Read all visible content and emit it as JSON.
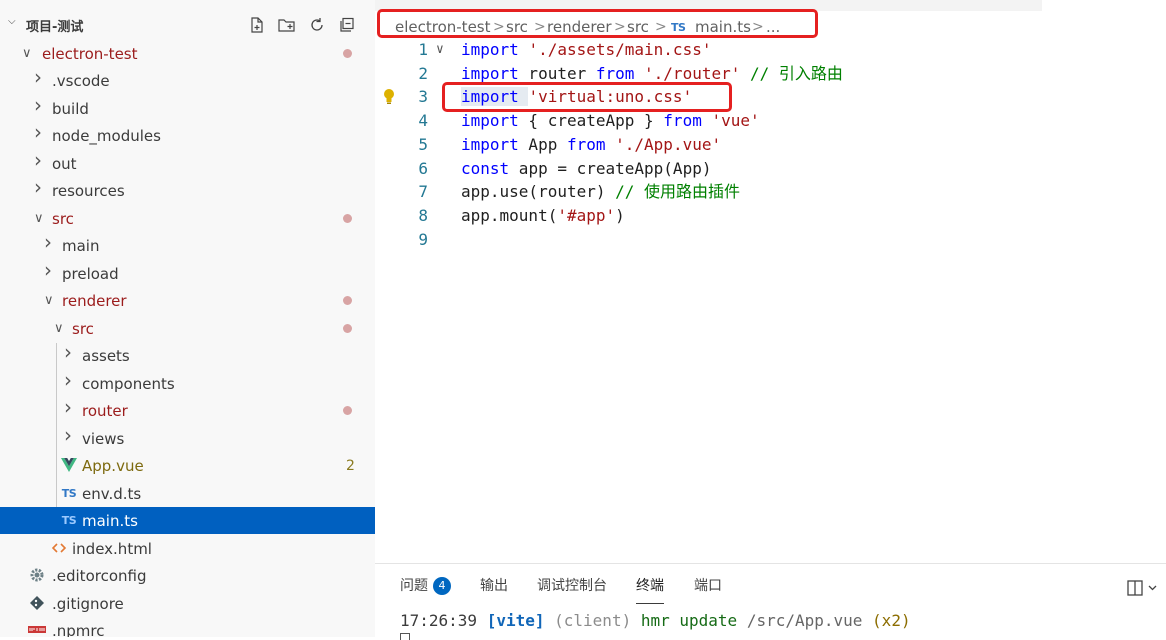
{
  "explorer": {
    "title": "项目-测试",
    "actions": [
      "new-file-icon",
      "new-folder-icon",
      "refresh-icon",
      "collapse-all-icon"
    ],
    "tree": [
      {
        "label": "electron-test",
        "kind": "folder-open",
        "modified": true
      },
      {
        "label": ".vscode",
        "kind": "folder"
      },
      {
        "label": "build",
        "kind": "folder"
      },
      {
        "label": "node_modules",
        "kind": "folder"
      },
      {
        "label": "out",
        "kind": "folder"
      },
      {
        "label": "resources",
        "kind": "folder"
      },
      {
        "label": "src",
        "kind": "folder-open",
        "modified": true
      },
      {
        "label": "main",
        "kind": "folder"
      },
      {
        "label": "preload",
        "kind": "folder"
      },
      {
        "label": "renderer",
        "kind": "folder-open",
        "modified": true
      },
      {
        "label": "src",
        "kind": "folder-open",
        "modified": true
      },
      {
        "label": "assets",
        "kind": "folder"
      },
      {
        "label": "components",
        "kind": "folder"
      },
      {
        "label": "router",
        "kind": "folder",
        "modified": true
      },
      {
        "label": "views",
        "kind": "folder"
      },
      {
        "label": "App.vue",
        "kind": "vue-file",
        "count": "2"
      },
      {
        "label": "env.d.ts",
        "kind": "ts-file",
        "icon_text": "TS"
      },
      {
        "label": "main.ts",
        "kind": "ts-file",
        "icon_text": "TS",
        "selected": true
      },
      {
        "label": "index.html",
        "kind": "html-file"
      },
      {
        "label": ".editorconfig",
        "kind": "gear-file"
      },
      {
        "label": ".gitignore",
        "kind": "git-file"
      },
      {
        "label": ".npmrc",
        "kind": "npm-file"
      }
    ]
  },
  "breadcrumb": {
    "items": [
      "electron-test",
      "src",
      "renderer",
      "src",
      "main.ts",
      "..."
    ],
    "file_icon_text": "TS",
    "separator": ">"
  },
  "editor": {
    "lines": [
      {
        "n": "1",
        "tokens": [
          [
            "kw",
            "import"
          ],
          [
            "pl",
            " "
          ],
          [
            "str",
            "'./assets/main.css'"
          ]
        ]
      },
      {
        "n": "2",
        "tokens": [
          [
            "kw",
            "import"
          ],
          [
            "pl",
            " router "
          ],
          [
            "kw",
            "from"
          ],
          [
            "pl",
            " "
          ],
          [
            "str",
            "'./router'"
          ],
          [
            "pl",
            " "
          ],
          [
            "cmt",
            "// 引入路由"
          ]
        ]
      },
      {
        "n": "3",
        "tokens": [
          [
            "kw",
            "import"
          ],
          [
            "pl",
            " "
          ],
          [
            "str",
            "'virtual:uno.css'"
          ]
        ]
      },
      {
        "n": "4",
        "tokens": [
          [
            "kw",
            "import"
          ],
          [
            "pl",
            " { createApp } "
          ],
          [
            "kw",
            "from"
          ],
          [
            "pl",
            " "
          ],
          [
            "str",
            "'vue'"
          ]
        ]
      },
      {
        "n": "5",
        "tokens": [
          [
            "kw",
            "import"
          ],
          [
            "pl",
            " App "
          ],
          [
            "kw",
            "from"
          ],
          [
            "pl",
            " "
          ],
          [
            "str",
            "'./App.vue'"
          ]
        ]
      },
      {
        "n": "6",
        "tokens": [
          [
            "kw",
            "const"
          ],
          [
            "pl",
            " app = createApp(App)"
          ]
        ]
      },
      {
        "n": "7",
        "tokens": [
          [
            "pl",
            "app.use(router) "
          ],
          [
            "cmt",
            "// 使用路由插件"
          ]
        ]
      },
      {
        "n": "8",
        "tokens": [
          [
            "pl",
            "app.mount("
          ],
          [
            "str",
            "'#app'"
          ],
          [
            "pl",
            ")"
          ]
        ]
      },
      {
        "n": "9",
        "tokens": []
      }
    ]
  },
  "panel": {
    "tabs": [
      {
        "label": "问题",
        "badge": "4"
      },
      {
        "label": "输出"
      },
      {
        "label": "调试控制台"
      },
      {
        "label": "终端",
        "active": true
      },
      {
        "label": "端口"
      }
    ],
    "terminal": {
      "time": "17:26:39",
      "tag": "[vite]",
      "scope": "(client)",
      "message": "hmr update",
      "path": "/src/App.vue",
      "repeat": "(x2)"
    }
  },
  "colors": {
    "selection": "#0060c0",
    "modified_text": "#9b1c1c",
    "keyword": "#0000ff",
    "string": "#a31515",
    "comment": "#008000",
    "annotation_box": "#e52020"
  }
}
